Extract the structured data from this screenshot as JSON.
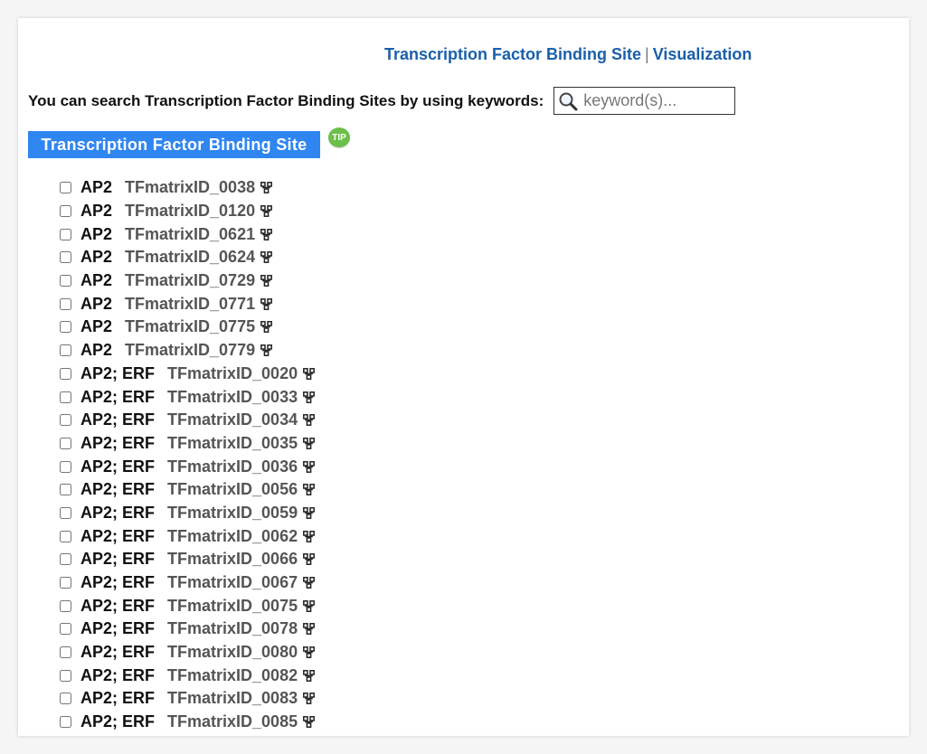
{
  "nav": {
    "link1": "Transcription Factor Binding Site",
    "separator": "|",
    "link2": "Visualization"
  },
  "search": {
    "label": "You can search Transcription Factor Binding Sites by using keywords:",
    "placeholder": "keyword(s)...",
    "value": "",
    "icon": "magnifier-icon"
  },
  "section": {
    "button_label": "Transcription Factor Binding Site",
    "tip_label": "TIP"
  },
  "colors": {
    "link": "#1a5fa8",
    "button_bg": "#2f86f1",
    "tip_bg": "#6cc04a"
  },
  "rows": [
    {
      "family": "AP2",
      "matrix": "TFmatrixID_0038",
      "checked": false
    },
    {
      "family": "AP2",
      "matrix": "TFmatrixID_0120",
      "checked": false
    },
    {
      "family": "AP2",
      "matrix": "TFmatrixID_0621",
      "checked": false
    },
    {
      "family": "AP2",
      "matrix": "TFmatrixID_0624",
      "checked": false
    },
    {
      "family": "AP2",
      "matrix": "TFmatrixID_0729",
      "checked": false
    },
    {
      "family": "AP2",
      "matrix": "TFmatrixID_0771",
      "checked": false
    },
    {
      "family": "AP2",
      "matrix": "TFmatrixID_0775",
      "checked": false
    },
    {
      "family": "AP2",
      "matrix": "TFmatrixID_0779",
      "checked": false
    },
    {
      "family": "AP2; ERF",
      "matrix": "TFmatrixID_0020",
      "checked": false
    },
    {
      "family": "AP2; ERF",
      "matrix": "TFmatrixID_0033",
      "checked": false
    },
    {
      "family": "AP2; ERF",
      "matrix": "TFmatrixID_0034",
      "checked": false
    },
    {
      "family": "AP2; ERF",
      "matrix": "TFmatrixID_0035",
      "checked": false
    },
    {
      "family": "AP2; ERF",
      "matrix": "TFmatrixID_0036",
      "checked": false
    },
    {
      "family": "AP2; ERF",
      "matrix": "TFmatrixID_0056",
      "checked": false
    },
    {
      "family": "AP2; ERF",
      "matrix": "TFmatrixID_0059",
      "checked": false
    },
    {
      "family": "AP2; ERF",
      "matrix": "TFmatrixID_0062",
      "checked": false
    },
    {
      "family": "AP2; ERF",
      "matrix": "TFmatrixID_0066",
      "checked": false
    },
    {
      "family": "AP2; ERF",
      "matrix": "TFmatrixID_0067",
      "checked": false
    },
    {
      "family": "AP2; ERF",
      "matrix": "TFmatrixID_0075",
      "checked": false
    },
    {
      "family": "AP2; ERF",
      "matrix": "TFmatrixID_0078",
      "checked": false
    },
    {
      "family": "AP2; ERF",
      "matrix": "TFmatrixID_0080",
      "checked": false
    },
    {
      "family": "AP2; ERF",
      "matrix": "TFmatrixID_0082",
      "checked": false
    },
    {
      "family": "AP2; ERF",
      "matrix": "TFmatrixID_0083",
      "checked": false
    },
    {
      "family": "AP2; ERF",
      "matrix": "TFmatrixID_0085",
      "checked": false
    }
  ],
  "row_icon": "tree-structure-icon"
}
